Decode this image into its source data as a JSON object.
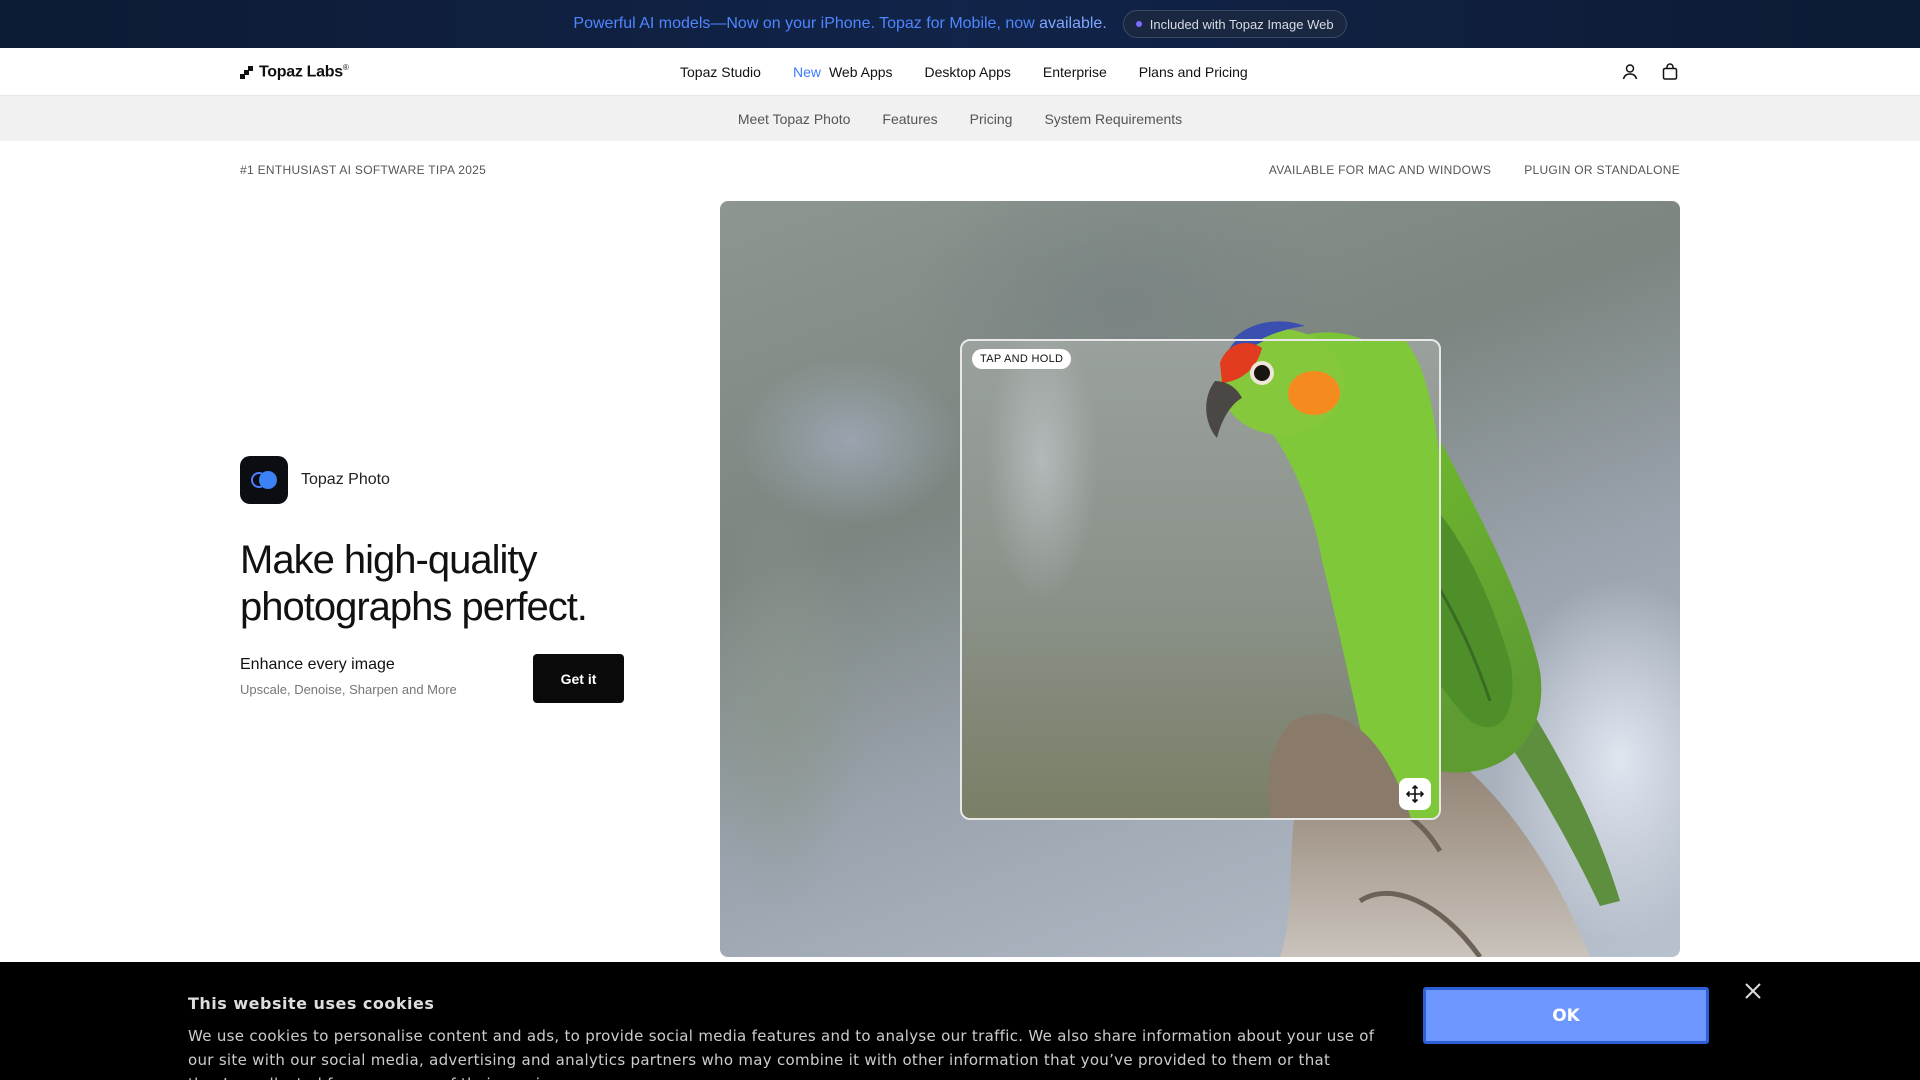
{
  "announcement": {
    "text": "Powerful AI models—Now on your iPhone. Topaz for Mobile, now",
    "text_tail": "available.",
    "pill_label": "Included with Topaz Image Web"
  },
  "nav": {
    "brand": "Topaz Labs",
    "brand_mark": "®",
    "links": [
      "Topaz Studio",
      "Web Apps",
      "Desktop Apps",
      "Enterprise",
      "Plans and Pricing"
    ],
    "new_badge": "New",
    "icons": [
      "user-icon",
      "bag-icon"
    ]
  },
  "subnav": {
    "items": [
      "Meet Topaz Photo",
      "Features",
      "Pricing",
      "System Requirements"
    ]
  },
  "meta": {
    "award": "#1 ENTHUSIAST AI SOFTWARE TIPA 2025",
    "platforms": "AVAILABLE FOR MAC AND WINDOWS",
    "mode": "PLUGIN OR STANDALONE"
  },
  "hero": {
    "product_name": "Topaz Photo",
    "headline": "Make high-quality photographs perfect.",
    "sub_title": "Enhance every image",
    "sub_desc": "Upscale, Denoise, Sharpen and More",
    "cta_label": "Get it",
    "compare_label": "TAP AND HOLD",
    "move_icon": "move-icon"
  },
  "cookie": {
    "title": "This website uses cookies",
    "text": "We use cookies to personalise content and ads, to provide social media features and to analyse our traffic. We also share information about your use of our site with our social media, advertising and analytics partners who may combine it with other information that you’ve provided to them or that they’ve collected from your use of their services.",
    "ok_label": "OK",
    "close_icon": "close-icon"
  },
  "colors": {
    "announce_bg": "#0d1a33",
    "announce_text": "#4f86ff",
    "accent_new": "#3b7bff",
    "ok_button": "#6d96ff"
  }
}
